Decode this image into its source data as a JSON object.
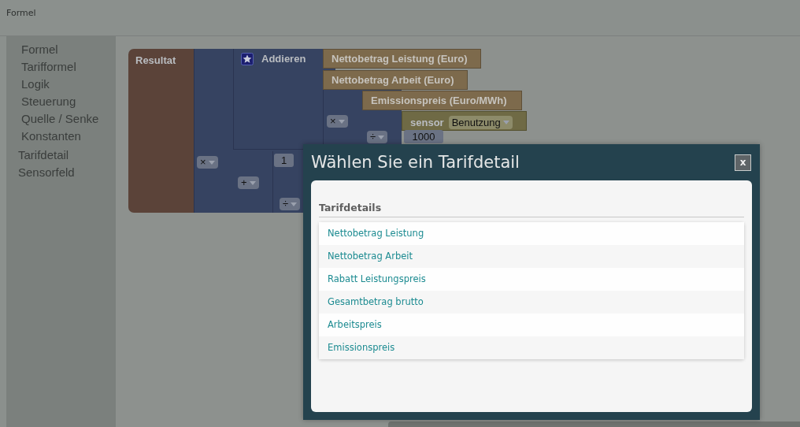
{
  "header": {
    "title": "Formel"
  },
  "sidebar": {
    "items": [
      {
        "label": "Formel",
        "kind": "category"
      },
      {
        "label": "Tarifformel",
        "kind": "category"
      },
      {
        "label": "Logik",
        "kind": "category"
      },
      {
        "label": "Steuerung",
        "kind": "category"
      },
      {
        "label": "Quelle / Senke",
        "kind": "category"
      },
      {
        "label": "Konstanten",
        "kind": "category"
      },
      {
        "label": "Tarifdetail",
        "kind": "entry"
      },
      {
        "label": "Sensorfeld",
        "kind": "entry"
      }
    ]
  },
  "workspace": {
    "result_block": {
      "label": "Resultat"
    },
    "add_block": {
      "label": "Addieren"
    },
    "values": [
      "Nettobetrag Leistung (Euro)",
      "Nettobetrag Arbeit (Euro)",
      "Emissionspreis (Euro/MWh)"
    ],
    "sensor": {
      "label": "sensor",
      "dropdown": "Benutzung"
    },
    "operators": [
      "×",
      "÷",
      "×",
      "+",
      "÷"
    ],
    "numbers": [
      "1000",
      "1"
    ]
  },
  "dialog": {
    "title": "Wählen Sie ein Tarifdetail",
    "close": "x",
    "section": "Tarifdetails",
    "items": [
      "Nettobetrag Leistung",
      "Nettobetrag Arbeit",
      "Rabatt Leistungspreis",
      "Gesamtbetrag brutto",
      "Arbeitspreis",
      "Emissionspreis"
    ]
  }
}
